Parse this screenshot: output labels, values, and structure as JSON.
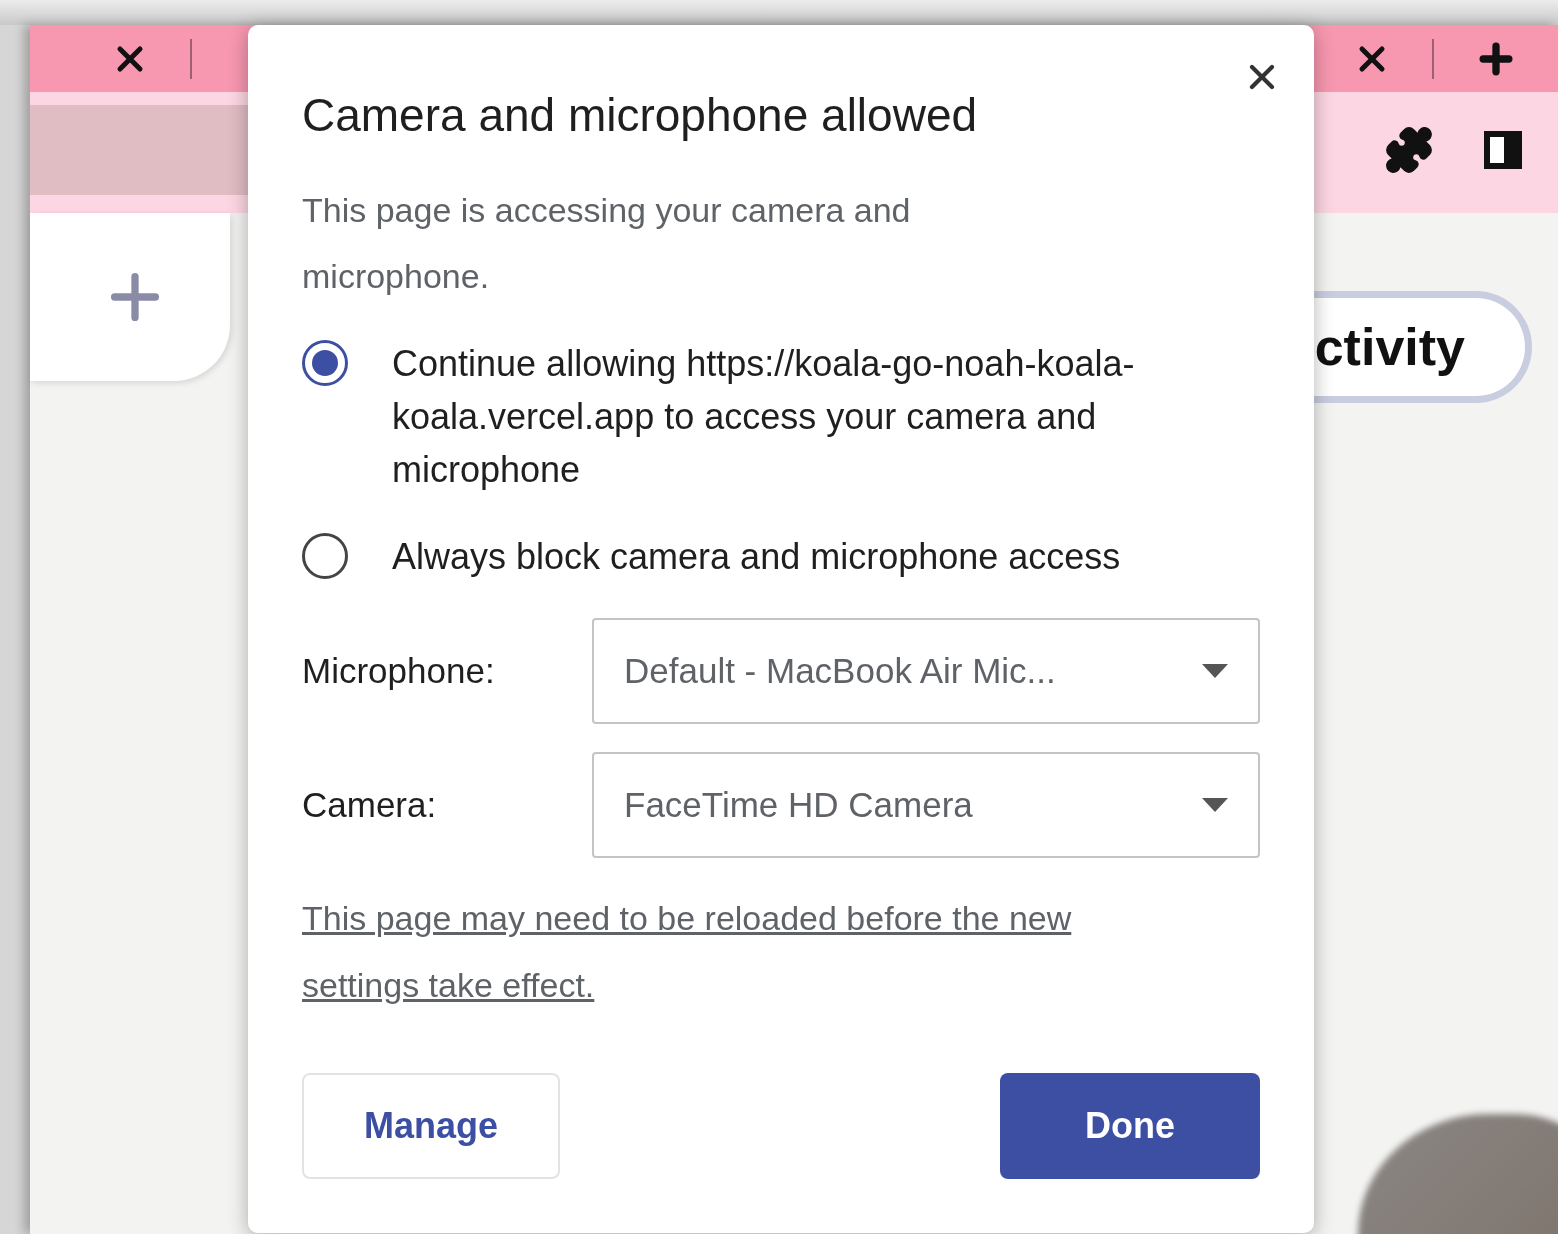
{
  "background": {
    "pill_label": "ctivity"
  },
  "dialog": {
    "title": "Camera and microphone allowed",
    "description": "This page is accessing your camera and microphone.",
    "options": [
      {
        "label": "Continue allowing https://koala-go-noah-koala-koala.vercel.app to access your camera and microphone",
        "selected": true
      },
      {
        "label": "Always block camera and microphone access",
        "selected": false
      }
    ],
    "fields": [
      {
        "label": "Microphone:",
        "value": "Default - MacBook Air Mic..."
      },
      {
        "label": "Camera:",
        "value": "FaceTime HD Camera"
      }
    ],
    "note": "This page may need to be reloaded before the new settings take effect.",
    "buttons": [
      {
        "label": "Manage",
        "kind": "secondary"
      },
      {
        "label": "Done",
        "kind": "primary"
      }
    ]
  }
}
